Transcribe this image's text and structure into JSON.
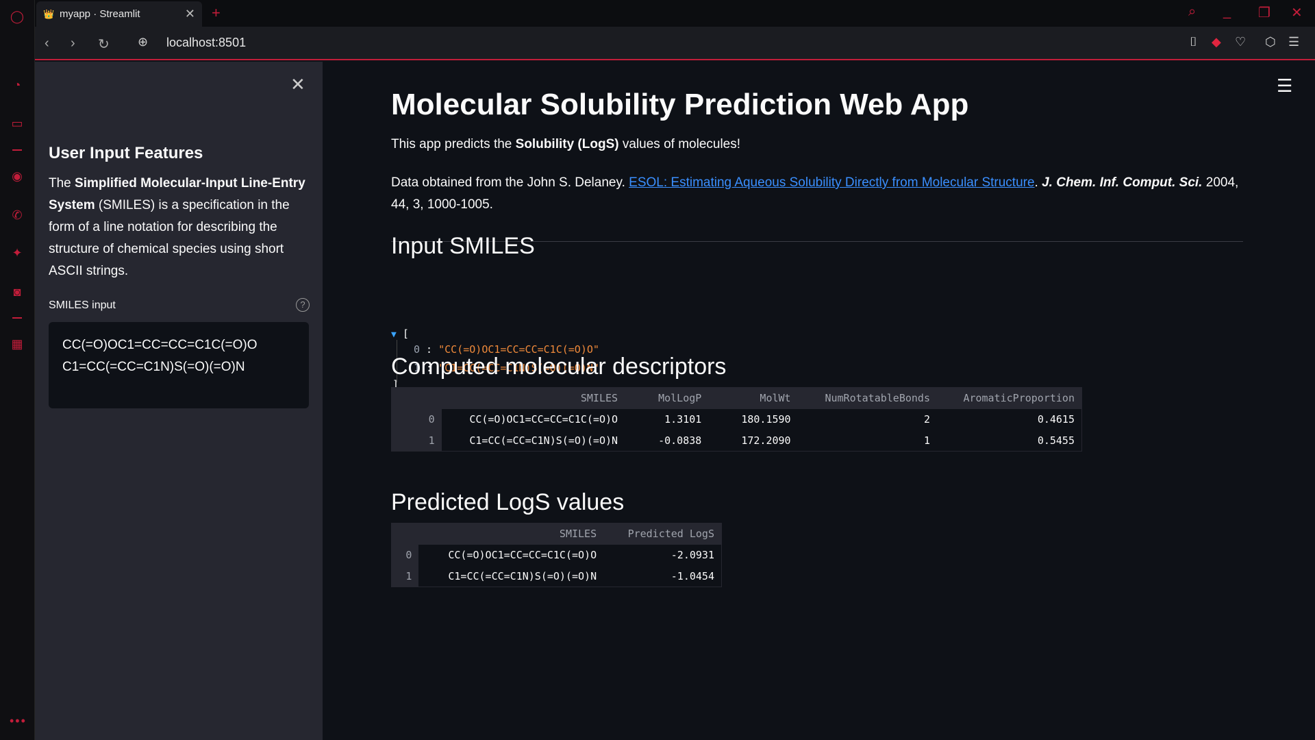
{
  "browser": {
    "tab_title": "myapp · Streamlit",
    "url": "localhost:8501"
  },
  "sidebar": {
    "title": "User Input Features",
    "desc_pre": "The ",
    "desc_bold": "Simplified Molecular-Input Line-Entry System",
    "desc_post": " (SMILES) is a specification in the form of a line notation for describing the structure of chemical species using short ASCII strings.",
    "input_label": "SMILES input",
    "input_value": "CC(=O)OC1=CC=CC=C1C(=O)O\nC1=CC(=CC=C1N)S(=O)(=O)N"
  },
  "main": {
    "title": "Molecular Solubility Prediction Web App",
    "intro_pre": "This app predicts the ",
    "intro_bold": "Solubility (LogS)",
    "intro_post": " values of molecules!",
    "data_pre": "Data obtained from the John S. Delaney. ",
    "data_link": "ESOL:  Estimating Aqueous Solubility Directly from Molecular Structure",
    "data_mid": ". ",
    "data_journal": "J. Chem. Inf. Comput. Sci.",
    "data_post": " 2004, 44, 3, 1000-1005.",
    "section_input": "Input SMILES",
    "json_open": "[",
    "json_close": "]",
    "json_items": [
      {
        "key": "0",
        "value": "\"CC(=O)OC1=CC=CC=C1C(=O)O\""
      },
      {
        "key": "1",
        "value": "\"C1=CC(=CC=C1N)S(=O)(=O)N\""
      }
    ],
    "section_descriptors": "Computed molecular descriptors",
    "descriptors": {
      "headers": [
        "",
        "SMILES",
        "MolLogP",
        "MolWt",
        "NumRotatableBonds",
        "AromaticProportion"
      ],
      "rows": [
        [
          "0",
          "CC(=O)OC1=CC=CC=C1C(=O)O",
          "1.3101",
          "180.1590",
          "2",
          "0.4615"
        ],
        [
          "1",
          "C1=CC(=CC=C1N)S(=O)(=O)N",
          "-0.0838",
          "172.2090",
          "1",
          "0.5455"
        ]
      ]
    },
    "section_predicted": "Predicted LogS values",
    "predicted": {
      "headers": [
        "",
        "SMILES",
        "Predicted LogS"
      ],
      "rows": [
        [
          "0",
          "CC(=O)OC1=CC=CC=C1C(=O)O",
          "-2.0931"
        ],
        [
          "1",
          "C1=CC(=CC=C1N)S(=O)(=O)N",
          "-1.0454"
        ]
      ]
    }
  }
}
